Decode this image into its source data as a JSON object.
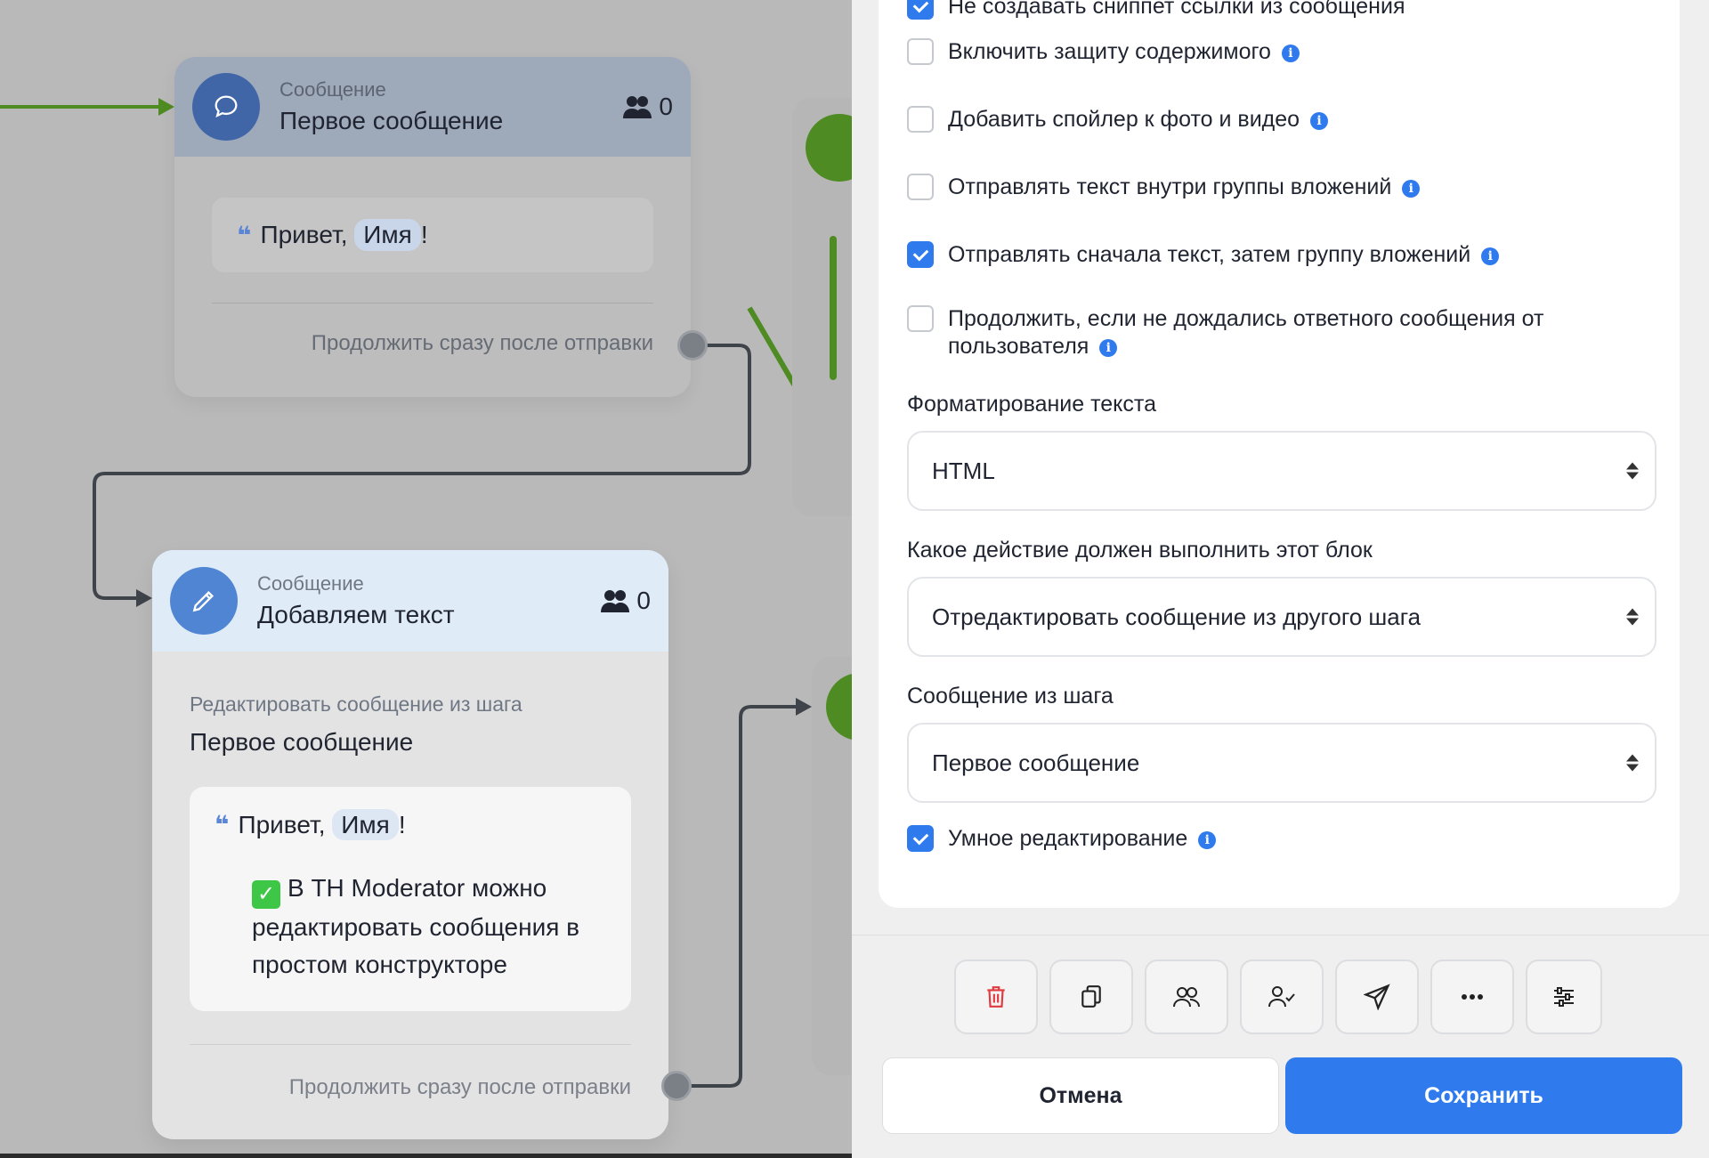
{
  "colors": {
    "accent": "#2f7bee",
    "connector_green": "#4f8b23",
    "connector_dark": "#3f434a",
    "danger": "#e0393e"
  },
  "canvas": {
    "card1": {
      "type": "Сообщение",
      "title": "Первое сообщение",
      "count": "0",
      "greeting": "Привет,",
      "variable": "Имя",
      "punct": "!",
      "continue": "Продолжить сразу после отправки",
      "icon": "chat-bubble-icon"
    },
    "card2": {
      "type": "Сообщение",
      "title": "Добавляем текст",
      "count": "0",
      "edit_label": "Редактировать сообщение из шага",
      "edit_value": "Первое сообщение",
      "greeting": "Привет,",
      "variable": "Имя",
      "punct": "!",
      "body_line1": "В TH Moderator можно",
      "body_line2": "редактировать сообщения в",
      "body_line3": "простом конструкторе",
      "continue": "Продолжить сразу после отправки",
      "icon": "pencil-icon"
    }
  },
  "panel": {
    "options": [
      {
        "label": "Не создавать сниппет ссылки из сообщения",
        "checked": true,
        "info": false
      },
      {
        "label": "Включить защиту содержимого",
        "checked": false,
        "info": true
      },
      {
        "label": "Добавить спойлер к фото и видео",
        "checked": false,
        "info": true
      },
      {
        "label": "Отправлять текст внутри группы вложений",
        "checked": false,
        "info": true
      },
      {
        "label": "Отправлять сначала текст, затем группу вложений",
        "checked": true,
        "info": true
      },
      {
        "label": "Продолжить, если не дождались ответного сообщения от",
        "label2": "пользователя",
        "checked": false,
        "info": true
      }
    ],
    "formatting": {
      "label": "Форматирование текста",
      "value": "HTML"
    },
    "action": {
      "label": "Какое действие должен выполнить этот блок",
      "value": "Отредактировать сообщение из другого шага"
    },
    "source": {
      "label": "Сообщение из шага",
      "value": "Первое сообщение"
    },
    "smart_edit": {
      "label": "Умное редактирование",
      "checked": true,
      "info": true
    },
    "toolbar": [
      "trash-icon",
      "copy-icon",
      "users-icon",
      "user-check-icon",
      "send-icon",
      "more-icon",
      "sliders-icon"
    ],
    "cancel": "Отмена",
    "save": "Сохранить"
  }
}
